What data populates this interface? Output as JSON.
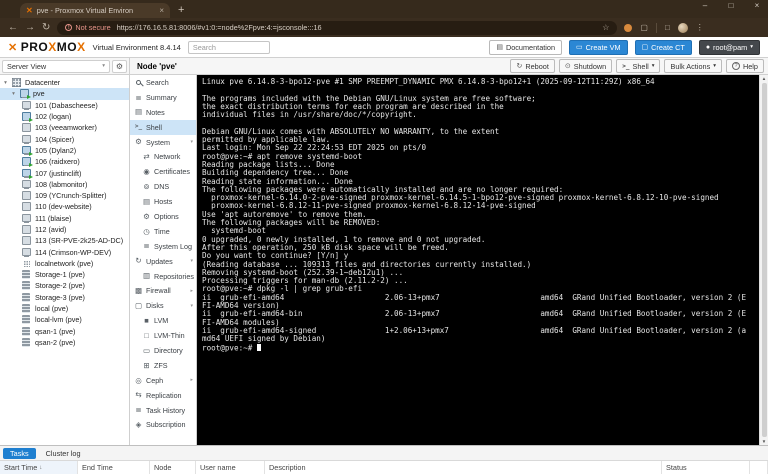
{
  "colors": {
    "proxmox_orange": "#e57000",
    "button_blue": "#2b87d4",
    "selection_blue": "#cde4f7",
    "tasks_tab_blue": "#1e7fd0",
    "not_secure_red": "#e8958b",
    "terminal_bg": "#000000",
    "terminal_fg": "#e6e6e6"
  },
  "icons": {
    "back": "←",
    "forward": "→",
    "reload": "↻",
    "star": "☆",
    "kebab": "⋮",
    "plus": "+",
    "close": "×",
    "minimize": "–",
    "maximize": "□",
    "caret_down": "▾",
    "caret_right": "▸",
    "gear": "⚙",
    "favicon": "✕",
    "book": "▤",
    "monitor": "▭",
    "cube": "▢",
    "user": "●",
    "reboot": "↻",
    "power": "⊙",
    "up": "▲",
    "down": "▼"
  },
  "icon_glyphs": {
    "summary": "≣",
    "notes": "▤",
    "shell": ">_",
    "system": "⚙",
    "network": "⇄",
    "certificates": "◉",
    "dns": "⊚",
    "hosts": "▤",
    "options": "⚙",
    "time": "◷",
    "syslog": "≣",
    "updates": "↻",
    "repositories": "▥",
    "firewall": "▩",
    "disks": "▢",
    "lvm": "■",
    "lvmthin": "□",
    "directory": "▭",
    "zfs": "⊞",
    "ceph": "◎",
    "replication": "⇆",
    "taskhistory": "≣",
    "subscription": "◈"
  },
  "browser": {
    "tab_title": "pve - Proxmox Virtual Environ",
    "not_secure_label": "Not secure",
    "url": "https://176.16.5.81:8006/#v1:0:=node%2Fpve:4:=jsconsole:::16"
  },
  "header": {
    "logo_segments": [
      "PRO",
      "X",
      "MO",
      "X"
    ],
    "version": "Virtual Environment 8.4.14",
    "search_placeholder": "Search",
    "documentation": "Documentation",
    "create_vm": "Create VM",
    "create_ct": "Create CT",
    "user": "root@pam"
  },
  "sidebar": {
    "view_label": "Server View",
    "tree": [
      {
        "label": "Datacenter",
        "icon": "datacenter",
        "level": 0,
        "expander": true
      },
      {
        "label": "pve",
        "icon": "node",
        "level": 1,
        "expander": true,
        "selected": true,
        "running": true
      },
      {
        "label": "101 (Dabascheese)",
        "icon": "vm",
        "level": 2
      },
      {
        "label": "102 (logan)",
        "icon": "vm",
        "level": 2,
        "running": true
      },
      {
        "label": "103 (veeamworker)",
        "icon": "vm",
        "level": 2
      },
      {
        "label": "104 (Spicer)",
        "icon": "vm",
        "level": 2
      },
      {
        "label": "105 (Dylan2)",
        "icon": "vm",
        "level": 2,
        "running": true
      },
      {
        "label": "106 (raidxero)",
        "icon": "vm",
        "level": 2,
        "running": true
      },
      {
        "label": "107 (justinclift)",
        "icon": "vm",
        "level": 2,
        "running": true
      },
      {
        "label": "108 (labmonitor)",
        "icon": "vm",
        "level": 2
      },
      {
        "label": "109 (YCrunch-Splitter)",
        "icon": "vm",
        "level": 2
      },
      {
        "label": "110 (dev-website)",
        "icon": "vm",
        "level": 2
      },
      {
        "label": "111 (blaise)",
        "icon": "vm",
        "level": 2
      },
      {
        "label": "112 (avid)",
        "icon": "vm",
        "level": 2
      },
      {
        "label": "113 (SR-PVE-2k25-AD-DC)",
        "icon": "vm",
        "level": 2
      },
      {
        "label": "114 (Crimson-WP-DEV)",
        "icon": "vm",
        "level": 2
      },
      {
        "label": "localnetwork (pve)",
        "icon": "network",
        "level": 2
      },
      {
        "label": "Storage-1 (pve)",
        "icon": "storage",
        "level": 2
      },
      {
        "label": "Storage-2 (pve)",
        "icon": "storage",
        "level": 2
      },
      {
        "label": "Storage-3 (pve)",
        "icon": "storage",
        "level": 2
      },
      {
        "label": "local (pve)",
        "icon": "storage",
        "level": 2
      },
      {
        "label": "local-lvm (pve)",
        "icon": "storage",
        "level": 2
      },
      {
        "label": "qsan-1 (pve)",
        "icon": "storage",
        "level": 2
      },
      {
        "label": "qsan-2 (pve)",
        "icon": "storage",
        "level": 2
      }
    ]
  },
  "panel_header": {
    "title": "Node 'pve'",
    "buttons": [
      {
        "label": "Reboot",
        "icon": "reboot"
      },
      {
        "label": "Shutdown",
        "icon": "power"
      },
      {
        "label": "Shell",
        "icon": "shell",
        "caret": true
      },
      {
        "label": "Bulk Actions",
        "caret": true
      },
      {
        "label": "Help",
        "icon": "help"
      }
    ]
  },
  "node_menu": [
    {
      "label": "Search",
      "icon": "search"
    },
    {
      "label": "Summary",
      "icon": "summary"
    },
    {
      "label": "Notes",
      "icon": "notes"
    },
    {
      "label": "Shell",
      "icon": "shell",
      "selected": true
    },
    {
      "label": "System",
      "icon": "system",
      "caret": "down"
    },
    {
      "label": "Network",
      "icon": "network",
      "level": 1
    },
    {
      "label": "Certificates",
      "icon": "certificates",
      "level": 1
    },
    {
      "label": "DNS",
      "icon": "dns",
      "level": 1
    },
    {
      "label": "Hosts",
      "icon": "hosts",
      "level": 1
    },
    {
      "label": "Options",
      "icon": "options",
      "level": 1
    },
    {
      "label": "Time",
      "icon": "time",
      "level": 1
    },
    {
      "label": "System Log",
      "icon": "syslog",
      "level": 1
    },
    {
      "label": "Updates",
      "icon": "updates",
      "caret": "down"
    },
    {
      "label": "Repositories",
      "icon": "repositories",
      "level": 1
    },
    {
      "label": "Firewall",
      "icon": "firewall",
      "caret": "right"
    },
    {
      "label": "Disks",
      "icon": "disks",
      "caret": "down"
    },
    {
      "label": "LVM",
      "icon": "lvm",
      "level": 1
    },
    {
      "label": "LVM-Thin",
      "icon": "lvmthin",
      "level": 1
    },
    {
      "label": "Directory",
      "icon": "directory",
      "level": 1
    },
    {
      "label": "ZFS",
      "icon": "zfs",
      "level": 1
    },
    {
      "label": "Ceph",
      "icon": "ceph",
      "caret": "right"
    },
    {
      "label": "Replication",
      "icon": "replication"
    },
    {
      "label": "Task History",
      "icon": "taskhistory"
    },
    {
      "label": "Subscription",
      "icon": "subscription"
    }
  ],
  "terminal": {
    "lines": [
      "Linux pve 6.14.8-3-bpo12-pve #1 SMP PREEMPT_DYNAMIC PMX 6.14.8-3-bpo12+1 (2025-09-12T11:29Z) x86_64",
      "",
      "The programs included with the Debian GNU/Linux system are free software;",
      "the exact distribution terms for each program are described in the",
      "individual files in /usr/share/doc/*/copyright.",
      "",
      "Debian GNU/Linux comes with ABSOLUTELY NO WARRANTY, to the extent",
      "permitted by applicable law.",
      "Last login: Mon Sep 22 22:24:53 EDT 2025 on pts/0",
      "root@pve:~# apt remove systemd-boot",
      "Reading package lists... Done",
      "Building dependency tree... Done",
      "Reading state information... Done",
      "The following packages were automatically installed and are no longer required:",
      "  proxmox-kernel-6.14.0-2-pve-signed proxmox-kernel-6.14.5-1-bpo12-pve-signed proxmox-kernel-6.8.12-10-pve-signed",
      "  proxmox-kernel-6.8.12-11-pve-signed proxmox-kernel-6.8.12-14-pve-signed",
      "Use 'apt autoremove' to remove them.",
      "The following packages will be REMOVED:",
      "  systemd-boot",
      "0 upgraded, 0 newly installed, 1 to remove and 0 not upgraded.",
      "After this operation, 250 kB disk space will be freed.",
      "Do you want to continue? [Y/n] y",
      "(Reading database ... 109313 files and directories currently installed.)",
      "Removing systemd-boot (252.39-1~deb12u1) ...",
      "Processing triggers for man-db (2.11.2-2) ...",
      "root@pve:~# dpkg -l | grep grub-efi",
      "ii  grub-efi-amd64                      2.06-13+pmx7                      amd64  GRand Unified Bootloader, version 2 (E",
      "FI-AMD64 version)",
      "ii  grub-efi-amd64-bin                  2.06-13+pmx7                      amd64  GRand Unified Bootloader, version 2 (E",
      "FI-AMD64 modules)",
      "ii  grub-efi-amd64-signed               1+2.06+13+pmx7                    amd64  GRand Unified Bootloader, version 2 (a",
      "md64 UEFI signed by Debian)",
      "root@pve:~# "
    ]
  },
  "bottom": {
    "tabs": [
      {
        "label": "Tasks",
        "active": true
      },
      {
        "label": "Cluster log",
        "active": false
      }
    ],
    "columns": [
      {
        "label": "Start Time",
        "sorted": true
      },
      {
        "label": "End Time"
      },
      {
        "label": "Node"
      },
      {
        "label": "User name"
      },
      {
        "label": "Description"
      },
      {
        "label": "Status"
      }
    ]
  }
}
